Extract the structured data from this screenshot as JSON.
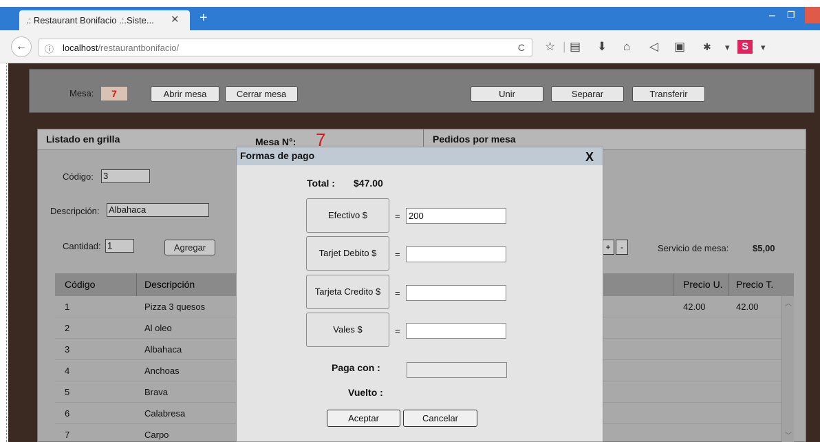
{
  "browser": {
    "tab_title": ".: Restaurant Bonifacio .:.Siste...",
    "tab_close": "✕",
    "new_tab": "+",
    "url_host": "localhost",
    "url_path": "/restaurantbonifacio/",
    "info_icon": "ⓘ",
    "reload_icon": "C",
    "back_icon": "←"
  },
  "toolbar": {
    "mesa_label": "Mesa:",
    "mesa_value": "7",
    "abrir_label": "Abrir mesa",
    "cerrar_label": "Cerrar mesa",
    "unir_label": "Unir",
    "separar_label": "Separar",
    "transferir_label": "Transferir"
  },
  "content": {
    "listado_title": "Listado en grilla",
    "mesa_nro_label": "Mesa N°:",
    "mesa_nro_value": "7",
    "pedidos_title": "Pedidos por mesa",
    "codigo_label": "Código:",
    "codigo_value": "3",
    "descripcion_label": "Descripción:",
    "descripcion_value": "Albahaca",
    "cantidad_label": "Cantidad:",
    "cantidad_value": "1",
    "agregar_label": "Agregar",
    "plus_label": "+",
    "minus_label": "-",
    "servicio_label": "Servicio de mesa:",
    "servicio_value": "$5,00"
  },
  "grid": {
    "headers": [
      "Código",
      "Descripción",
      "Precio U.",
      "Precio T."
    ],
    "rows": [
      {
        "codigo": "1",
        "descripcion": "Pizza 3 quesos"
      },
      {
        "codigo": "2",
        "descripcion": "Al oleo"
      },
      {
        "codigo": "3",
        "descripcion": "Albahaca"
      },
      {
        "codigo": "4",
        "descripcion": "Anchoas"
      },
      {
        "codigo": "5",
        "descripcion": "Brava"
      },
      {
        "codigo": "6",
        "descripcion": "Calabresa"
      },
      {
        "codigo": "7",
        "descripcion": "Carpo"
      }
    ],
    "pedido_precio_u": "42.00",
    "pedido_precio_t": "42.00"
  },
  "modal": {
    "title": "Formas de pago",
    "close": "X",
    "total_label": "Total :",
    "total_value": "$47.00",
    "efectivo_label": "Efectivo $",
    "efectivo_value": "200",
    "debito_label": "Tarjet Debito $",
    "credito_label": "Tarjeta Credito $",
    "vales_label": "Vales $",
    "equals": "=",
    "paga_label": "Paga con :",
    "vuelto_label": "Vuelto :",
    "aceptar_label": "Aceptar",
    "cancelar_label": "Cancelar"
  }
}
